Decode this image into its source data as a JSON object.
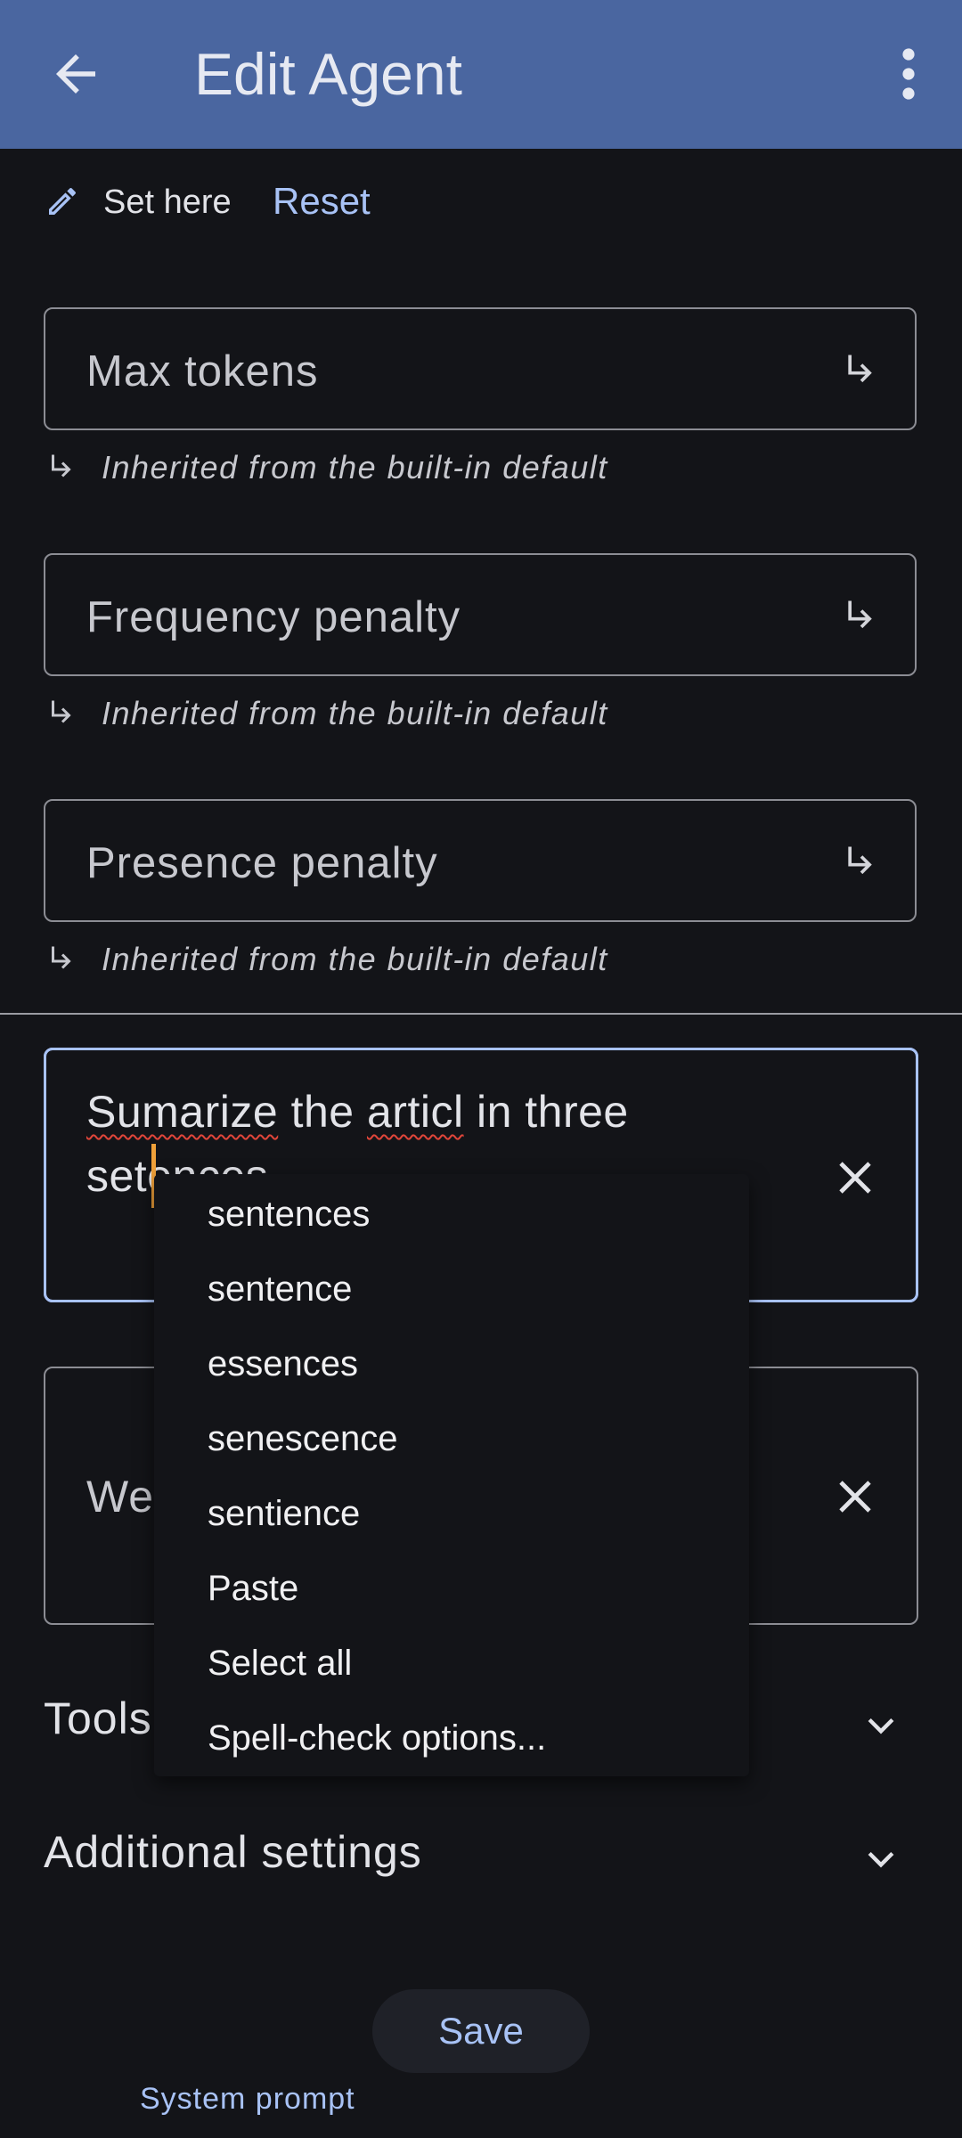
{
  "appbar": {
    "title": "Edit Agent",
    "back_icon": "arrow-left-icon",
    "more_icon": "more-vert-icon",
    "color": "#4a66a0"
  },
  "override": {
    "label": "Set here",
    "reset": "Reset"
  },
  "fields": [
    {
      "label": "Max tokens",
      "hint": "Inherited from the built-in default"
    },
    {
      "label": "Frequency penalty",
      "hint": "Inherited from the built-in default"
    },
    {
      "label": "Presence penalty",
      "hint": "Inherited from the built-in default"
    }
  ],
  "system_prompt": {
    "label": "System prompt",
    "words": [
      "Sumarize",
      " the ",
      "articl",
      " in three",
      "setences"
    ]
  },
  "second_field": {
    "visible_text": "We"
  },
  "sections": {
    "tools": "Tools",
    "additional": "Additional settings"
  },
  "context_menu": [
    "sentences",
    "sentence",
    "essences",
    "senescence",
    "sentience",
    "Paste",
    "Select all",
    "Spell-check options..."
  ],
  "save": "Save",
  "colors": {
    "accent": "#a8c2f5",
    "background": "#131418",
    "cursor": "#f0a13a",
    "spell_error": "#e0453a"
  }
}
